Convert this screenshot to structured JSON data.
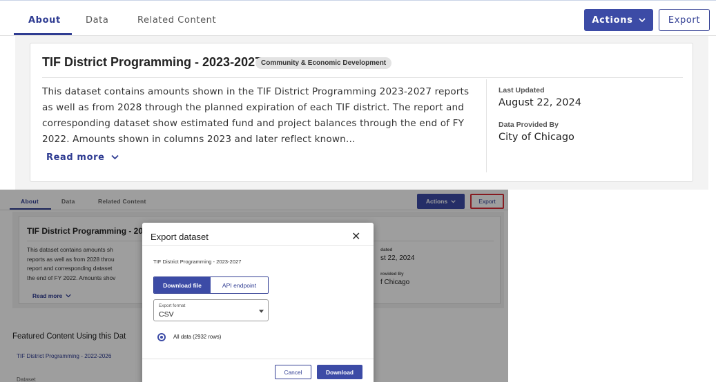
{
  "top": {
    "tabs": [
      {
        "label": "About",
        "active": true
      },
      {
        "label": "Data",
        "active": false
      },
      {
        "label": "Related Content",
        "active": false
      }
    ],
    "actions_label": "Actions",
    "export_label": "Export",
    "dataset": {
      "title": "TIF District Programming - 2023-2027",
      "category": "Community & Economic Development",
      "description": "This dataset contains amounts shown in the TIF District Programming 2023-2027 reports as well as from 2028 through the planned expiration of each TIF district. The report and corresponding dataset show estimated fund and project balances through the end of FY 2022. Amounts shown in columns 2023 and later reflect known…",
      "read_more": "Read more",
      "last_updated_label": "Last Updated",
      "last_updated_value": "August 22, 2024",
      "provided_by_label": "Data Provided By",
      "provided_by_value": "City of Chicago"
    }
  },
  "bottom": {
    "tabs": [
      {
        "label": "About",
        "active": true
      },
      {
        "label": "Data",
        "active": false
      },
      {
        "label": "Related Content",
        "active": false
      }
    ],
    "actions_label": "Actions",
    "export_label": "Export",
    "card_title": "TIF District Programming - 20",
    "card_desc_lines": [
      "This dataset contains amounts sh",
      "reports as well as from 2028 throu",
      "report and corresponding dataset",
      "the end of FY 2022. Amounts shov"
    ],
    "read_more": "Read more",
    "meta_label_1": "dated",
    "meta_value_1": "st 22, 2024",
    "meta_label_2": "rovided By",
    "meta_value_2": "f Chicago",
    "featured_heading": "Featured Content Using this Dat",
    "featured_link": "TIF District Programming - 2022-2026",
    "featured_next": "Dataset"
  },
  "modal": {
    "title": "Export dataset",
    "close_symbol": "✕",
    "dataset_name": "TIF District Programming - 2023-2027",
    "tab_download": "Download file",
    "tab_api": "API endpoint",
    "format_label": "Export format",
    "format_value": "CSV",
    "option_all_data": "All data (2932 rows)",
    "cancel_label": "Cancel",
    "download_label": "Download"
  },
  "colors": {
    "primary": "#3c4ba6",
    "highlight_border": "#d92b35"
  },
  "icons": {
    "chevron": "chevron-down-icon",
    "close": "close-icon",
    "radio": "radio-selected-icon"
  }
}
